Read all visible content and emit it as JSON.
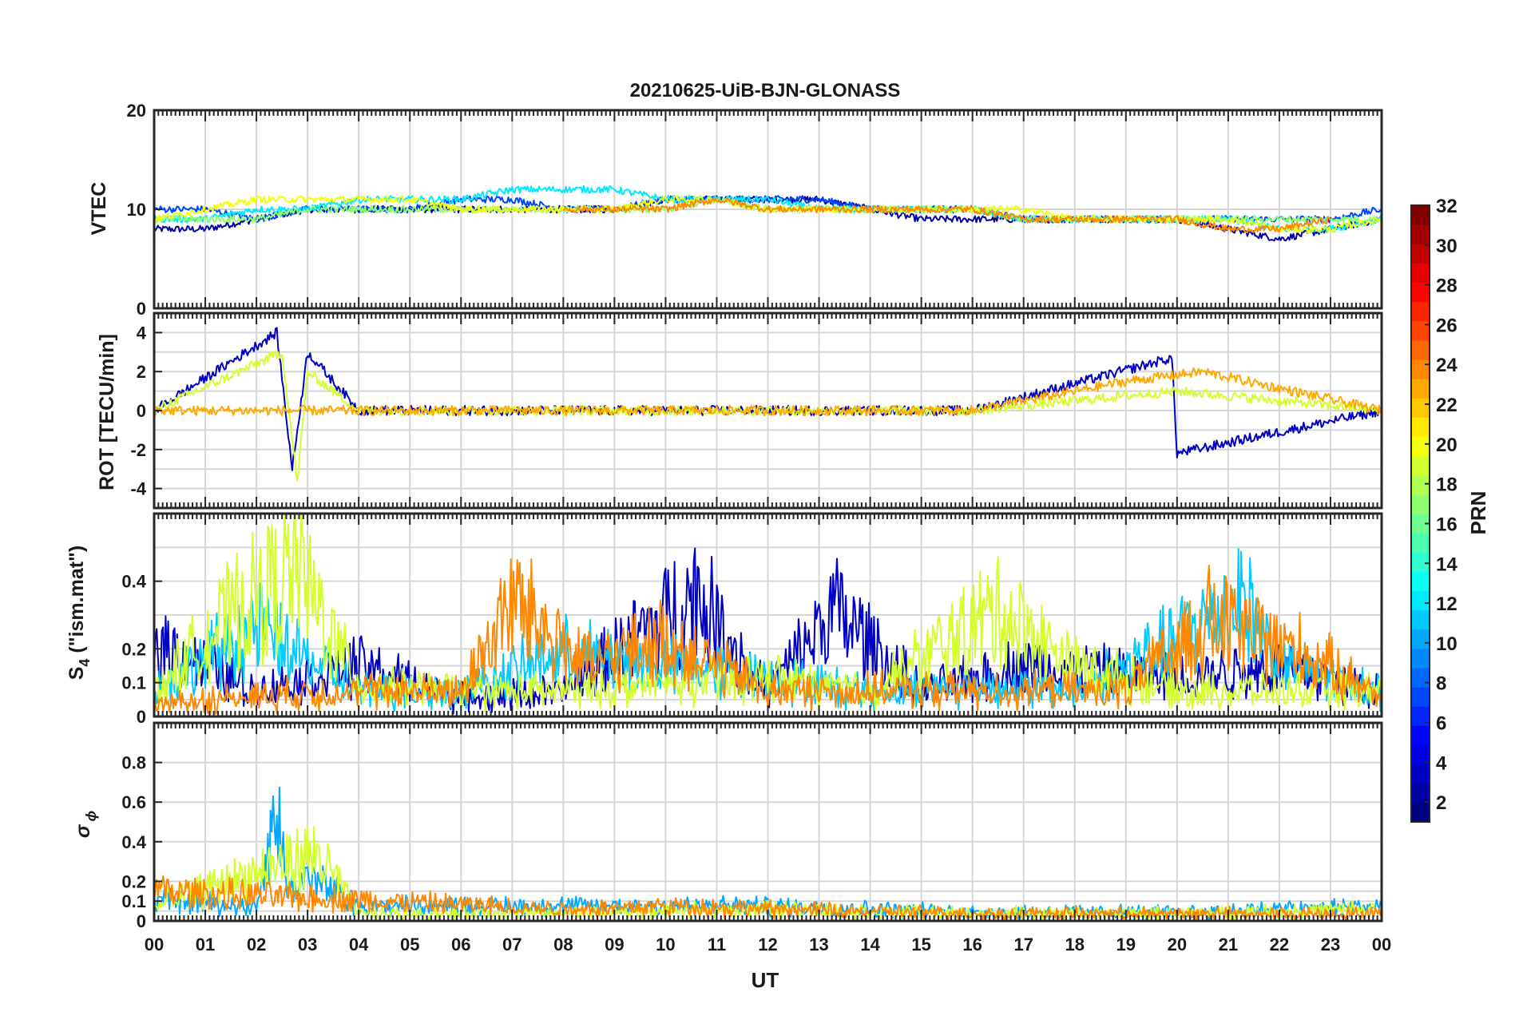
{
  "title": "20210625-UiB-BJN-GLONASS",
  "x_axis": {
    "label": "UT",
    "tick_labels": [
      "00",
      "01",
      "02",
      "03",
      "04",
      "05",
      "06",
      "07",
      "08",
      "09",
      "10",
      "11",
      "12",
      "13",
      "14",
      "15",
      "16",
      "17",
      "18",
      "19",
      "20",
      "21",
      "22",
      "23",
      "00"
    ],
    "range_hours": [
      0,
      24
    ]
  },
  "colorbar": {
    "label": "PRN",
    "range": [
      1,
      32
    ],
    "tick_labels": [
      "2",
      "4",
      "6",
      "8",
      "10",
      "12",
      "14",
      "16",
      "18",
      "20",
      "22",
      "24",
      "26",
      "28",
      "30",
      "32"
    ],
    "colormap": "jet"
  },
  "panels": [
    {
      "id": "vtec",
      "ylabel": "VTEC",
      "yticks": [
        "0",
        "10",
        "20"
      ]
    },
    {
      "id": "rot",
      "ylabel": "ROT [TECU/min]",
      "yticks": [
        "-4",
        "-2",
        "0",
        "2",
        "4"
      ]
    },
    {
      "id": "s4",
      "ylabel_main": "S",
      "ylabel_sub": "4",
      "ylabel_rest": " (\"ism.mat\")",
      "yticks": [
        "0",
        "0.1",
        "0.2",
        "0.4"
      ]
    },
    {
      "id": "sigphi",
      "ylabel_main": "σ",
      "ylabel_sub": "ϕ",
      "yticks": [
        "0",
        "0.1",
        "0.2",
        "0.4",
        "0.6",
        "0.8"
      ]
    }
  ],
  "chart_data": [
    {
      "type": "line",
      "ylabel": "VTEC",
      "ylim": [
        0,
        20
      ],
      "xlim": [
        0,
        24
      ],
      "grid": true,
      "series": [
        {
          "prn": 2,
          "x": [
            0,
            1,
            2,
            3,
            4,
            5,
            6,
            7,
            8,
            9,
            10,
            11,
            12,
            13,
            14,
            15,
            16,
            17,
            18,
            19,
            20,
            21,
            22,
            23,
            24
          ],
          "y": [
            8,
            8,
            9,
            10,
            10,
            10,
            10,
            10,
            10,
            10,
            11,
            11,
            11,
            11,
            10,
            9,
            9,
            9,
            9,
            9,
            9,
            8,
            7,
            8,
            9
          ]
        },
        {
          "prn": 7,
          "x": [
            0,
            1,
            2,
            3,
            4,
            5,
            6,
            7,
            8,
            9,
            10,
            11,
            12,
            13,
            14,
            15,
            16,
            17,
            18,
            19,
            20,
            21,
            22,
            23,
            24
          ],
          "y": [
            10,
            10,
            9,
            10,
            10,
            10,
            11,
            11,
            10,
            10,
            11,
            11,
            11,
            11,
            10,
            10,
            10,
            9,
            9,
            9,
            9,
            9,
            9,
            9,
            10
          ]
        },
        {
          "prn": 12,
          "x": [
            0,
            1,
            2,
            3,
            4,
            5,
            6,
            7,
            8,
            9,
            10,
            11,
            12,
            13,
            14,
            15,
            16,
            17,
            18,
            19,
            20,
            21,
            22,
            23,
            24
          ],
          "y": [
            9,
            9,
            10,
            10,
            11,
            11,
            11,
            12,
            12,
            12,
            11,
            11,
            11,
            10,
            10,
            10,
            10,
            9,
            9,
            9,
            9,
            9,
            8,
            8,
            9
          ]
        },
        {
          "prn": 17,
          "x": [
            0,
            1,
            2,
            3,
            4,
            5,
            6,
            7,
            8,
            9,
            10,
            11,
            12,
            13,
            14,
            15,
            16,
            17,
            18,
            19,
            20,
            21,
            22,
            23,
            24
          ],
          "y": [
            9,
            9,
            9,
            10,
            10,
            10,
            10,
            10,
            10,
            10,
            10,
            11,
            10,
            10,
            10,
            10,
            10,
            9,
            9,
            9,
            9,
            9,
            9,
            9,
            9
          ]
        },
        {
          "prn": 20,
          "x": [
            0,
            1,
            2,
            3,
            4,
            5,
            6,
            7,
            8,
            9,
            10,
            11,
            12,
            13,
            14,
            15,
            16,
            17,
            18,
            19,
            20,
            21,
            22,
            23,
            24
          ],
          "y": [
            9,
            10,
            11,
            11,
            11,
            11,
            10,
            10,
            10,
            10,
            11,
            11,
            10,
            10,
            10,
            10,
            10,
            10,
            9,
            9,
            9,
            9,
            8,
            8,
            9
          ]
        },
        {
          "prn": 24,
          "x": [
            8,
            9,
            10,
            11,
            12,
            13,
            14,
            15,
            16,
            17,
            18,
            19,
            20,
            21,
            22,
            23
          ],
          "y": [
            10,
            10,
            10,
            11,
            10,
            10,
            10,
            10,
            10,
            9,
            9,
            9,
            9,
            8,
            8,
            9
          ]
        }
      ]
    },
    {
      "type": "line",
      "ylabel": "ROT [TECU/min]",
      "ylim": [
        -5,
        5
      ],
      "xlim": [
        0,
        24
      ],
      "grid": true,
      "series": [
        {
          "prn": 3,
          "x": [
            0,
            2.4,
            2.7,
            3,
            4,
            8,
            12,
            16,
            19.9,
            20,
            24
          ],
          "y": [
            0,
            4,
            -3,
            3,
            0,
            0,
            0,
            0,
            2.7,
            -2.2,
            0
          ]
        },
        {
          "prn": 19,
          "x": [
            0,
            2.5,
            2.8,
            3,
            4,
            8,
            12,
            16,
            20,
            24
          ],
          "y": [
            0,
            3,
            -3.7,
            2,
            0,
            0,
            0,
            0,
            1,
            0
          ]
        },
        {
          "prn": 23,
          "x": [
            0,
            8,
            12,
            16,
            19,
            20.5,
            24
          ],
          "y": [
            0,
            0,
            0,
            0,
            1.5,
            2,
            0
          ]
        }
      ]
    },
    {
      "type": "line",
      "ylabel": "S4 (\"ism.mat\")",
      "ylim": [
        0,
        0.6
      ],
      "xlim": [
        0,
        24
      ],
      "grid": true,
      "series": [
        {
          "prn": 3,
          "x": [
            0,
            2,
            4,
            6,
            8,
            10.6,
            12,
            13.3,
            15,
            17,
            20,
            22,
            24
          ],
          "y": [
            0.3,
            0.1,
            0.2,
            0.07,
            0.1,
            0.48,
            0.1,
            0.42,
            0.1,
            0.2,
            0.15,
            0.2,
            0.1
          ]
        },
        {
          "prn": 11,
          "x": [
            0,
            2,
            4,
            6,
            8,
            10,
            12,
            14,
            16,
            18,
            20,
            21.3,
            22,
            24
          ],
          "y": [
            0.1,
            0.35,
            0.1,
            0.1,
            0.25,
            0.2,
            0.15,
            0.1,
            0.12,
            0.1,
            0.3,
            0.47,
            0.2,
            0.1
          ]
        },
        {
          "prn": 19,
          "x": [
            0,
            1.4,
            2.8,
            4,
            6,
            8,
            12,
            14,
            16.5,
            18,
            20,
            24
          ],
          "y": [
            0.1,
            0.38,
            0.58,
            0.12,
            0.1,
            0.1,
            0.15,
            0.1,
            0.42,
            0.2,
            0.1,
            0.1
          ]
        },
        {
          "prn": 24,
          "x": [
            0,
            2,
            4,
            6,
            7,
            8.5,
            10,
            12,
            16,
            19,
            20.6,
            22.5,
            24
          ],
          "y": [
            0.05,
            0.08,
            0.1,
            0.1,
            0.46,
            0.2,
            0.3,
            0.1,
            0.1,
            0.1,
            0.38,
            0.25,
            0.08
          ]
        }
      ]
    },
    {
      "type": "line",
      "ylabel": "σϕ",
      "ylim": [
        0,
        1
      ],
      "xlim": [
        0,
        24
      ],
      "grid": true,
      "series": [
        {
          "prn": 10,
          "x": [
            0,
            2,
            2.4,
            2.6,
            3,
            4,
            8,
            12,
            16,
            20,
            24
          ],
          "y": [
            0.15,
            0.1,
            0.78,
            0.2,
            0.3,
            0.1,
            0.1,
            0.1,
            0.06,
            0.06,
            0.1
          ]
        },
        {
          "prn": 19,
          "x": [
            0,
            2.7,
            3.2,
            4,
            8,
            12,
            16,
            20,
            24
          ],
          "y": [
            0.1,
            0.4,
            0.45,
            0.05,
            0.05,
            0.08,
            0.05,
            0.05,
            0.08
          ]
        },
        {
          "prn": 24,
          "x": [
            0,
            8,
            10,
            12,
            16,
            20,
            24
          ],
          "y": [
            0.2,
            0.08,
            0.1,
            0.08,
            0.05,
            0.05,
            0.05
          ]
        }
      ]
    }
  ]
}
